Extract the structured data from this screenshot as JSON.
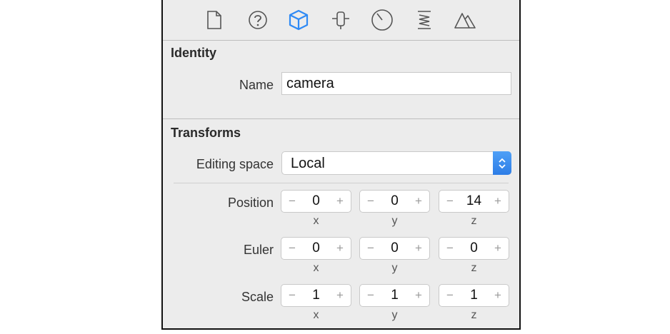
{
  "toolbar": {
    "icons": [
      "file-icon",
      "help-icon",
      "node-inspector-icon",
      "attributes-icon",
      "physics-icon",
      "materials-icon",
      "scene-icon"
    ],
    "accent": "#2f8af5"
  },
  "identity": {
    "title": "Identity",
    "name_label": "Name",
    "name_value": "camera"
  },
  "transforms": {
    "title": "Transforms",
    "editing_space_label": "Editing space",
    "editing_space_value": "Local",
    "position": {
      "label": "Position",
      "x": "0",
      "y": "0",
      "z": "14"
    },
    "euler": {
      "label": "Euler",
      "x": "0",
      "y": "0",
      "z": "0"
    },
    "scale": {
      "label": "Scale",
      "x": "1",
      "y": "1",
      "z": "1"
    },
    "axes": [
      "x",
      "y",
      "z"
    ],
    "minus": "−",
    "plus": "+"
  }
}
